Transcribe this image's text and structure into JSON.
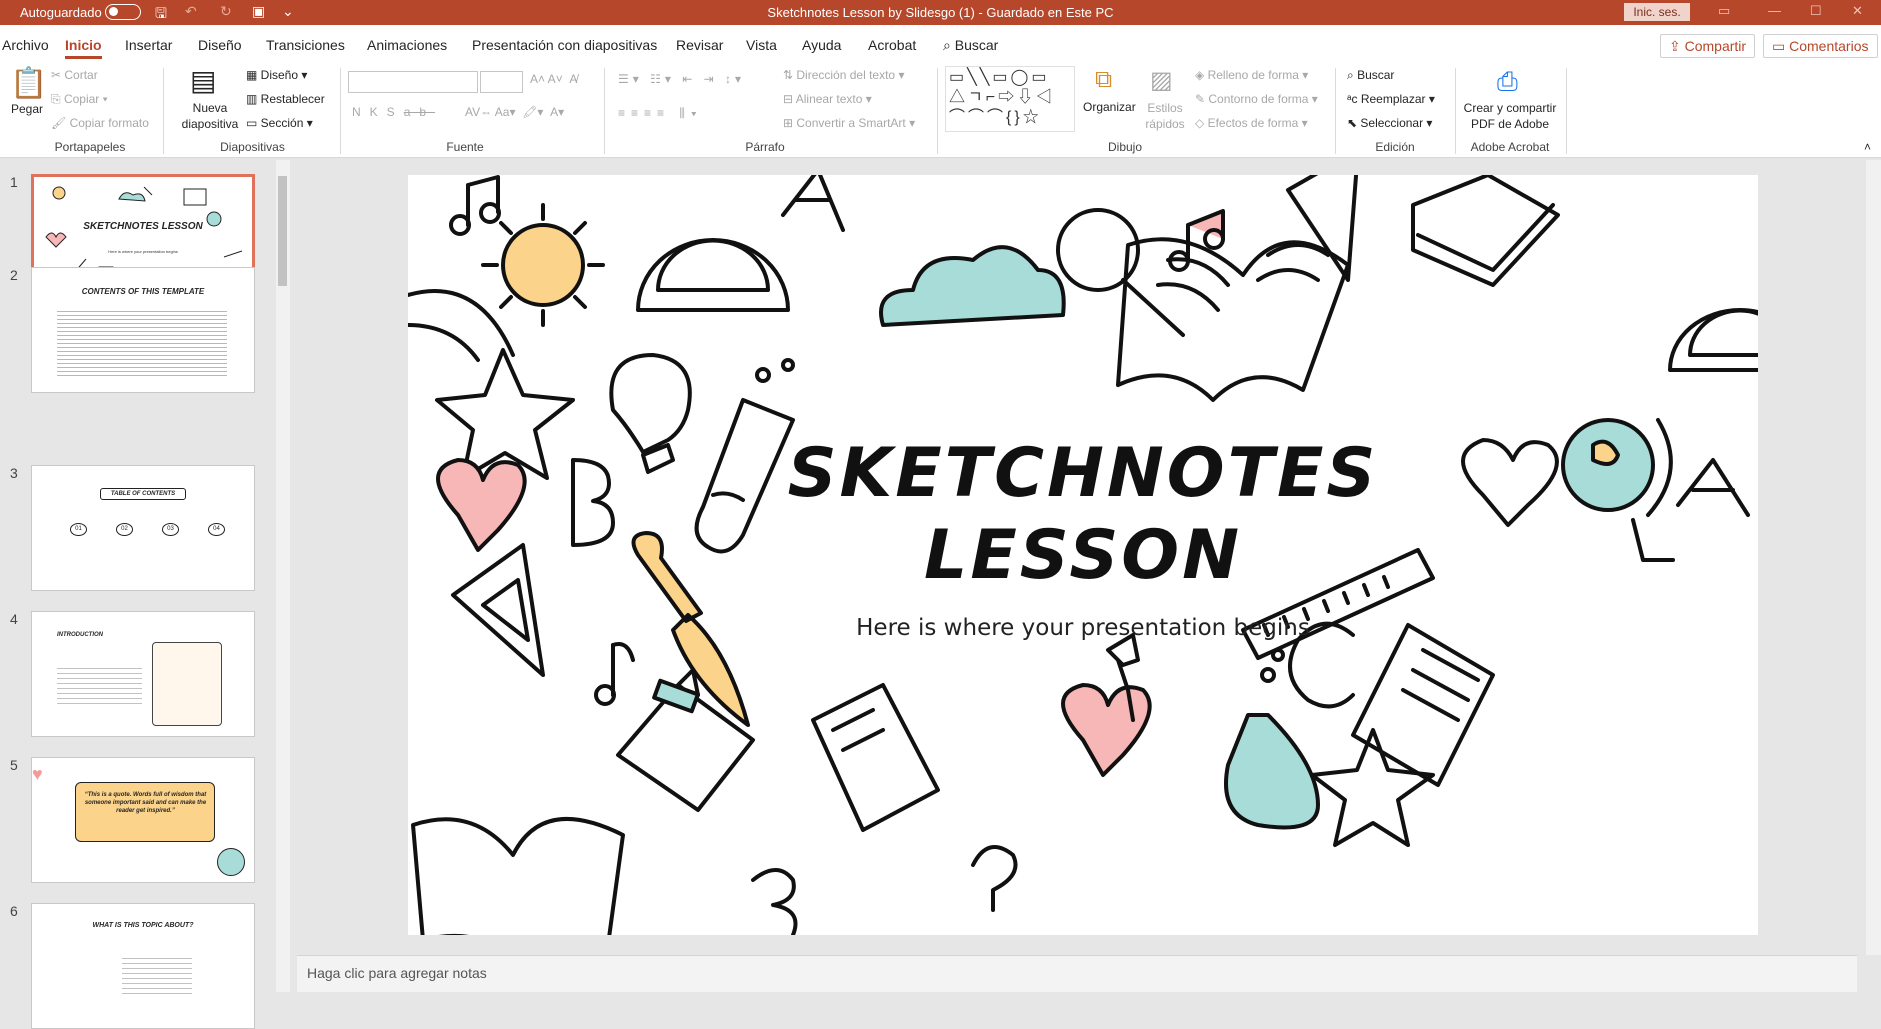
{
  "titlebar": {
    "autosave": "Autoguardado",
    "document": "Sketchnotes Lesson by Slidesgo (1)  -  Guardado en Este PC",
    "signin": "Inic. ses."
  },
  "tabs": {
    "items": [
      "Archivo",
      "Inicio",
      "Insertar",
      "Diseño",
      "Transiciones",
      "Animaciones",
      "Presentación con diapositivas",
      "Revisar",
      "Vista",
      "Ayuda",
      "Acrobat"
    ],
    "search": "Buscar",
    "share": "Compartir",
    "comments": "Comentarios"
  },
  "ribbon": {
    "clipboard": {
      "paste": "Pegar",
      "cut": "Cortar",
      "copy": "Copiar",
      "format": "Copiar formato",
      "label": "Portapapeles"
    },
    "slides": {
      "new": "Nueva diapositiva",
      "layout": "Diseño",
      "reset": "Restablecer",
      "section": "Sección",
      "label": "Diapositivas"
    },
    "font": {
      "label": "Fuente"
    },
    "paragraph": {
      "text_dir": "Dirección del texto",
      "align": "Alinear texto",
      "smartart": "Convertir a SmartArt",
      "label": "Párrafo"
    },
    "drawing": {
      "arrange": "Organizar",
      "styles": "Estilos rápidos",
      "fill": "Relleno de forma",
      "outline": "Contorno de forma",
      "effects": "Efectos de forma",
      "label": "Dibujo"
    },
    "editing": {
      "find": "Buscar",
      "replace": "Reemplazar",
      "select": "Seleccionar",
      "label": "Edición"
    },
    "acrobat": {
      "create": "Crear y compartir PDF de Adobe",
      "label": "Adobe Acrobat"
    }
  },
  "thumbnails": [
    {
      "n": "1",
      "title": "SKETCHNOTES LESSON",
      "sub": "Here is where your presentation begins"
    },
    {
      "n": "2",
      "title": "CONTENTS OF THIS TEMPLATE"
    },
    {
      "n": "3",
      "title": "TABLE OF CONTENTS",
      "items": [
        "01",
        "02",
        "03",
        "04"
      ]
    },
    {
      "n": "4",
      "title": "INTRODUCTION"
    },
    {
      "n": "5",
      "title": "“This is a quote. Words full of wisdom that someone important said and can make the reader get inspired.”"
    },
    {
      "n": "6",
      "title": "WHAT IS THIS TOPIC ABOUT?"
    }
  ],
  "slide": {
    "title_line1": "SKETCHNOTES",
    "title_line2": "LESSON",
    "subtitle": "Here is where your presentation begins",
    "colors": {
      "yellow": "#fbd38a",
      "mint": "#a8dcd9",
      "pink": "#f7b7b7"
    }
  },
  "notes": {
    "placeholder": "Haga clic para agregar notas"
  }
}
